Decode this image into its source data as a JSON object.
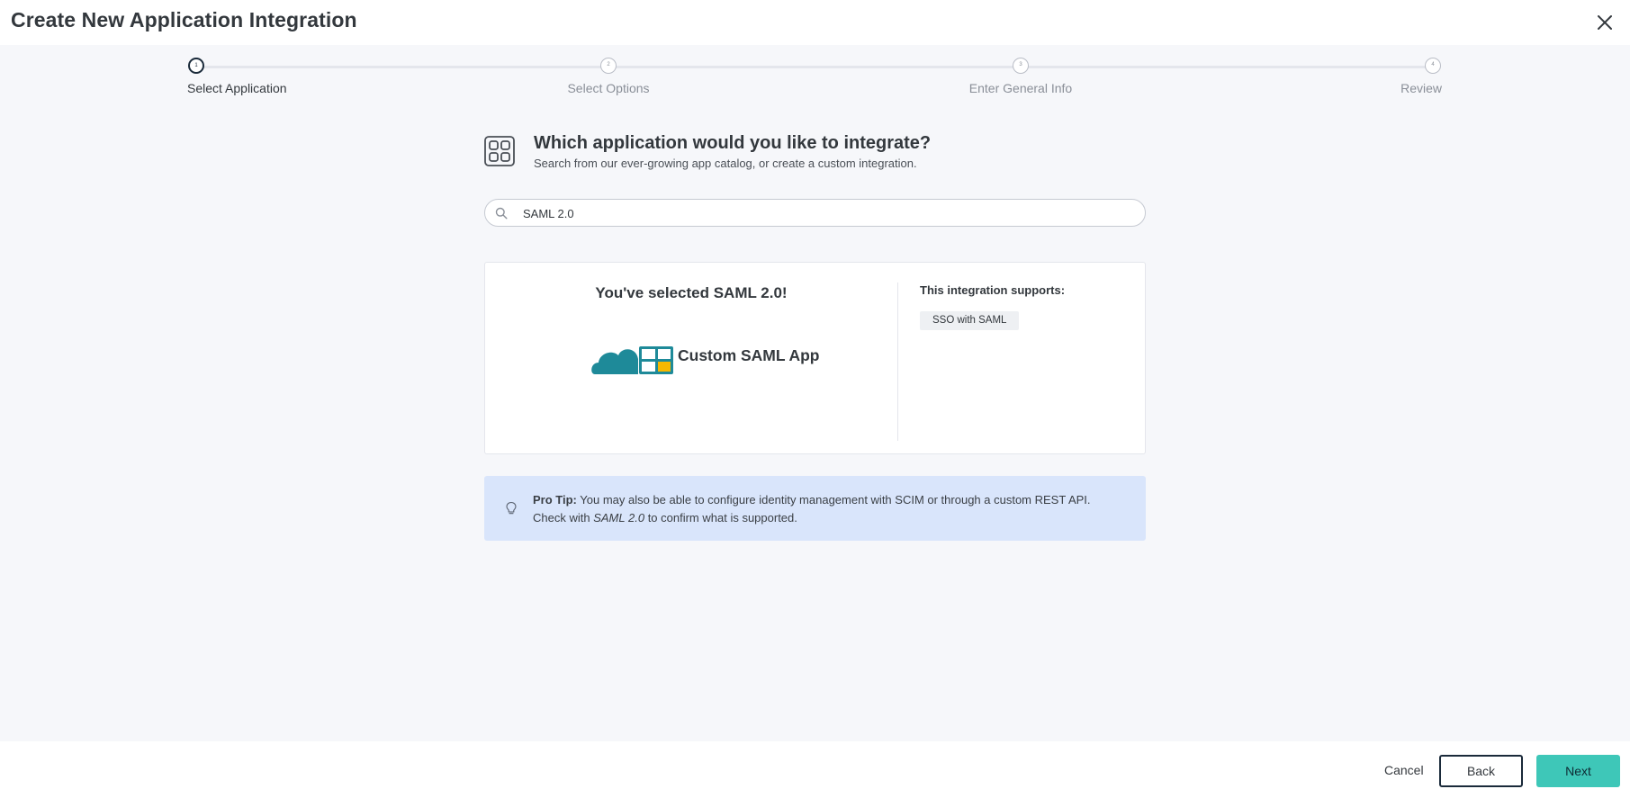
{
  "header": {
    "title": "Create New Application Integration",
    "close_icon": "close-icon"
  },
  "stepper": {
    "steps": [
      {
        "number": "1",
        "label": "Select Application",
        "state": "active"
      },
      {
        "number": "2",
        "label": "Select Options",
        "state": "inactive"
      },
      {
        "number": "3",
        "label": "Enter General Info",
        "state": "inactive"
      },
      {
        "number": "4",
        "label": "Review",
        "state": "inactive"
      }
    ]
  },
  "question": {
    "icon": "app-catalog-icon",
    "title": "Which application would you like to integrate?",
    "subtitle": "Search from our ever-growing app catalog, or create a custom integration."
  },
  "search": {
    "icon": "search-icon",
    "value": "SAML 2.0"
  },
  "selection": {
    "title": "You've selected SAML 2.0!",
    "app_name": "Custom SAML App",
    "supports_title": "This integration supports:",
    "supports": [
      "SSO with SAML"
    ]
  },
  "pro_tip": {
    "icon": "lightbulb-icon",
    "label": "Pro Tip:",
    "line1": "You may also be able to configure identity management with SCIM or through a custom REST API.",
    "line2_prefix": "Check with",
    "line2_app": "SAML 2.0",
    "line2_suffix": "to confirm what is supported."
  },
  "footer": {
    "cancel_label": "Cancel",
    "back_label": "Back",
    "next_label": "Next"
  },
  "colors": {
    "accent": "#3ec7b8",
    "brand_teal": "#1e8a99",
    "brand_yellow": "#f5b800",
    "tip_background": "#d9e5fb",
    "page_background": "#f6f7fa"
  }
}
